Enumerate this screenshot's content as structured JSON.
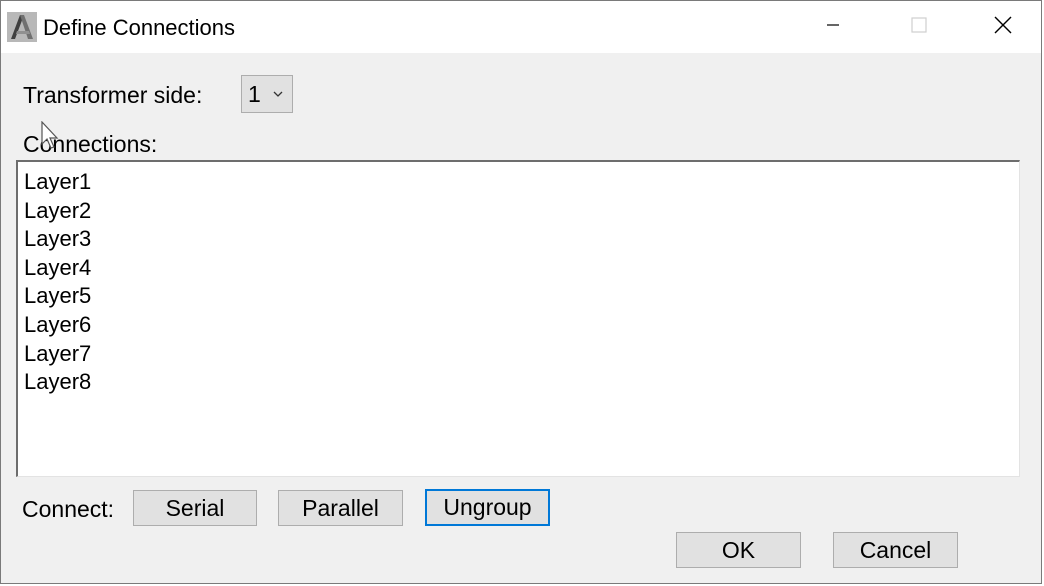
{
  "window": {
    "title": "Define Connections",
    "app_icon": "app-logo-icon",
    "controls": [
      "minimize-icon",
      "maximize-icon",
      "close-icon"
    ]
  },
  "transformer_side": {
    "label": "Transformer side:",
    "selected": "1"
  },
  "connections": {
    "label": "Connections:",
    "items": [
      "Layer1",
      "Layer2",
      "Layer3",
      "Layer4",
      "Layer5",
      "Layer6",
      "Layer7",
      "Layer8"
    ]
  },
  "connect": {
    "label": "Connect:",
    "serial": "Serial",
    "parallel": "Parallel",
    "ungroup": "Ungroup"
  },
  "footer": {
    "ok": "OK",
    "cancel": "Cancel"
  },
  "colors": {
    "titlebar": "#ffffff",
    "dialog_bg": "#f0f0f0",
    "button_bg": "#e1e1e1",
    "focus_border": "#0078d7"
  }
}
